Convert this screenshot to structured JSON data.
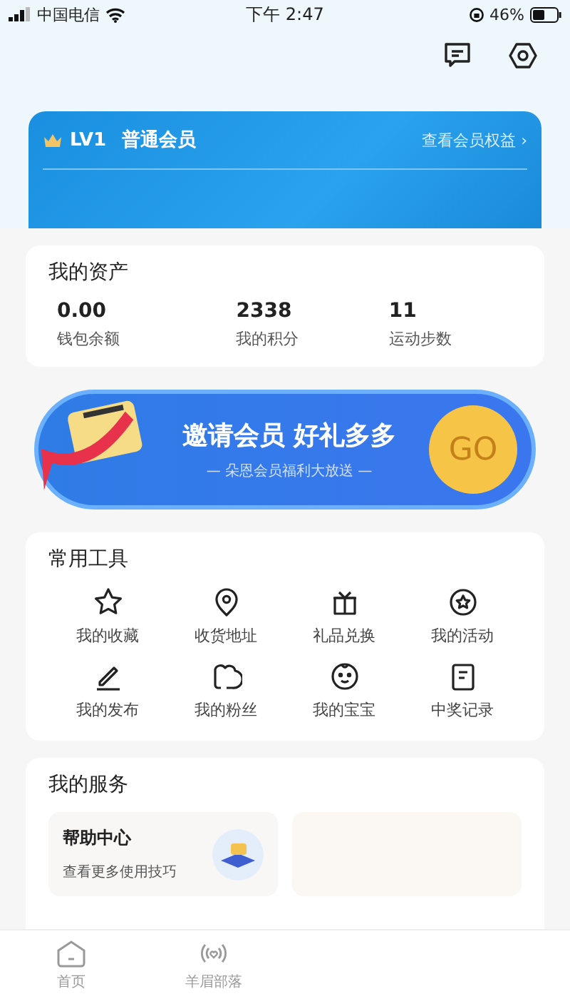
{
  "status_bar": {
    "carrier": "中国电信",
    "time": "下午 2:47",
    "battery": "46%"
  },
  "member": {
    "level": "LV1",
    "tier": "普通会员",
    "link": "查看会员权益 ›"
  },
  "assets": {
    "title": "我的资产",
    "items": [
      {
        "value": "0.00",
        "label": "钱包余额"
      },
      {
        "value": "2338",
        "label": "我的积分"
      },
      {
        "value": "11",
        "label": "运动步数"
      }
    ]
  },
  "banner": {
    "title": "邀请会员 好礼多多",
    "subtitle": "— 朵恩会员福利大放送 —",
    "button": "GO"
  },
  "tools": {
    "title": "常用工具",
    "items": [
      {
        "label": "我的收藏"
      },
      {
        "label": "收货地址"
      },
      {
        "label": "礼品兑换"
      },
      {
        "label": "我的活动"
      },
      {
        "label": "我的发布"
      },
      {
        "label": "我的粉丝"
      },
      {
        "label": "我的宝宝"
      },
      {
        "label": "中奖记录"
      }
    ]
  },
  "services": {
    "title": "我的服务",
    "items": [
      {
        "title": "帮助中心",
        "subtitle": "查看更多使用技巧"
      }
    ]
  },
  "tab_bar": [
    {
      "label": "首页"
    },
    {
      "label": "羊眉部落"
    }
  ]
}
